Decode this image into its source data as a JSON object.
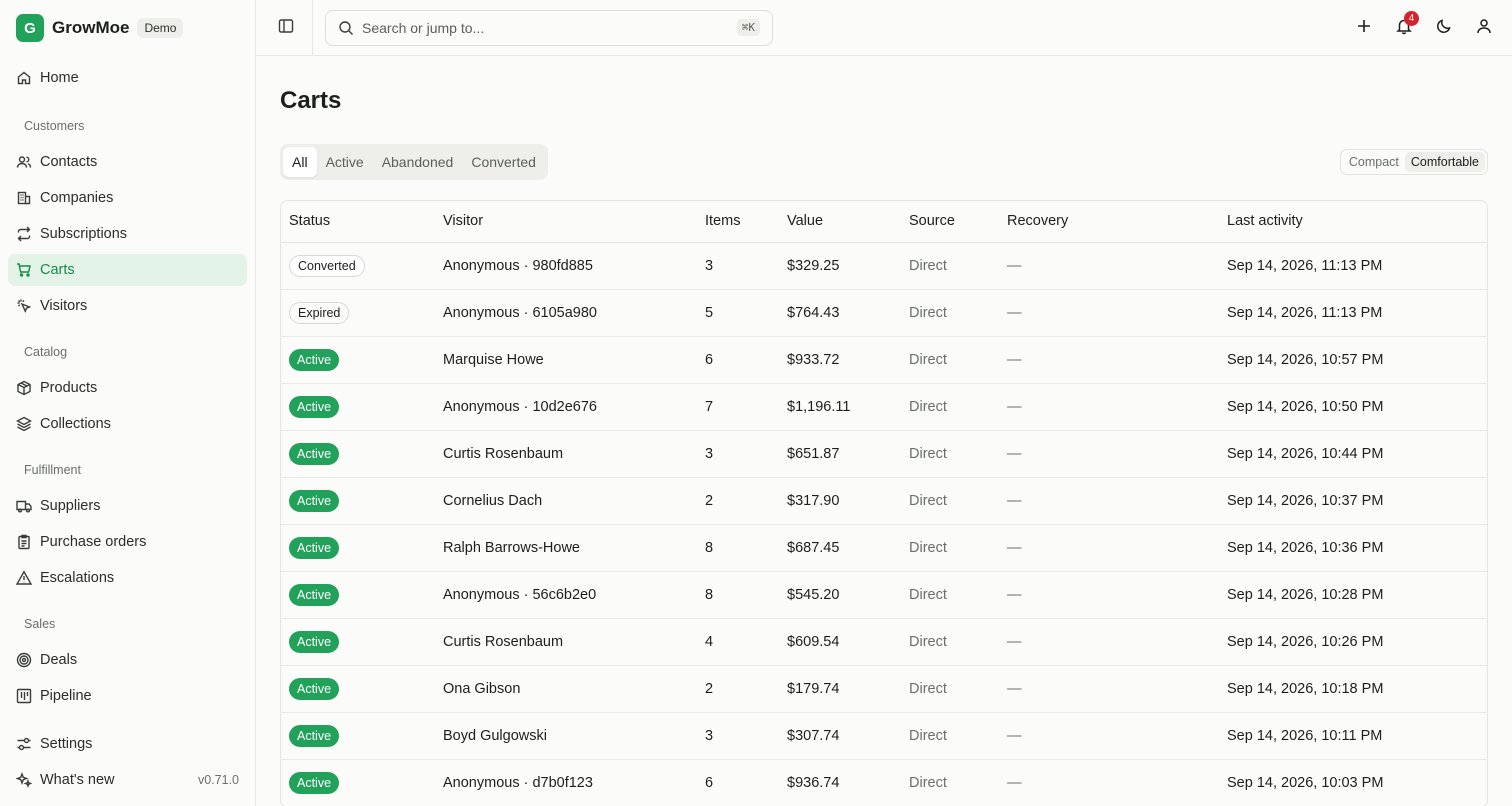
{
  "brand": {
    "logo_letter": "G",
    "name": "GrowMoe",
    "badge": "Demo"
  },
  "sidebar": {
    "home": "Home",
    "sections": [
      {
        "title": "Customers",
        "items": [
          {
            "label": "Contacts",
            "icon": "users-icon"
          },
          {
            "label": "Companies",
            "icon": "building-icon"
          },
          {
            "label": "Subscriptions",
            "icon": "repeat-icon"
          },
          {
            "label": "Carts",
            "icon": "cart-icon",
            "active": true
          },
          {
            "label": "Visitors",
            "icon": "cursor-click-icon"
          }
        ]
      },
      {
        "title": "Catalog",
        "items": [
          {
            "label": "Products",
            "icon": "box-icon"
          },
          {
            "label": "Collections",
            "icon": "layers-icon"
          }
        ]
      },
      {
        "title": "Fulfillment",
        "items": [
          {
            "label": "Suppliers",
            "icon": "truck-icon"
          },
          {
            "label": "Purchase orders",
            "icon": "clipboard-icon"
          },
          {
            "label": "Escalations",
            "icon": "warning-icon"
          }
        ]
      },
      {
        "title": "Sales",
        "items": [
          {
            "label": "Deals",
            "icon": "target-icon"
          },
          {
            "label": "Pipeline",
            "icon": "kanban-icon"
          }
        ]
      }
    ],
    "settings": "Settings",
    "whats_new": "What's new",
    "version": "v0.71.0"
  },
  "topbar": {
    "search_placeholder": "Search or jump to...",
    "search_shortcut": "⌘K",
    "notification_count": "4"
  },
  "page": {
    "title": "Carts",
    "tabs": [
      "All",
      "Active",
      "Abandoned",
      "Converted"
    ],
    "active_tab": "All",
    "density": {
      "compact": "Compact",
      "comfortable": "Comfortable",
      "selected": "Comfortable"
    }
  },
  "table": {
    "columns": [
      "Status",
      "Visitor",
      "Items",
      "Value",
      "Source",
      "Recovery",
      "Last activity"
    ],
    "rows": [
      {
        "status": "Converted",
        "visitor": "Anonymous · 980fd885",
        "items": "3",
        "value": "$329.25",
        "source": "Direct",
        "recovery": "—",
        "last_activity": "Sep 14, 2026, 11:13 PM"
      },
      {
        "status": "Expired",
        "visitor": "Anonymous · 6105a980",
        "items": "5",
        "value": "$764.43",
        "source": "Direct",
        "recovery": "—",
        "last_activity": "Sep 14, 2026, 11:13 PM"
      },
      {
        "status": "Active",
        "visitor": "Marquise Howe",
        "items": "6",
        "value": "$933.72",
        "source": "Direct",
        "recovery": "—",
        "last_activity": "Sep 14, 2026, 10:57 PM"
      },
      {
        "status": "Active",
        "visitor": "Anonymous · 10d2e676",
        "items": "7",
        "value": "$1,196.11",
        "source": "Direct",
        "recovery": "—",
        "last_activity": "Sep 14, 2026, 10:50 PM"
      },
      {
        "status": "Active",
        "visitor": "Curtis Rosenbaum",
        "items": "3",
        "value": "$651.87",
        "source": "Direct",
        "recovery": "—",
        "last_activity": "Sep 14, 2026, 10:44 PM"
      },
      {
        "status": "Active",
        "visitor": "Cornelius Dach",
        "items": "2",
        "value": "$317.90",
        "source": "Direct",
        "recovery": "—",
        "last_activity": "Sep 14, 2026, 10:37 PM"
      },
      {
        "status": "Active",
        "visitor": "Ralph Barrows-Howe",
        "items": "8",
        "value": "$687.45",
        "source": "Direct",
        "recovery": "—",
        "last_activity": "Sep 14, 2026, 10:36 PM"
      },
      {
        "status": "Active",
        "visitor": "Anonymous · 56c6b2e0",
        "items": "8",
        "value": "$545.20",
        "source": "Direct",
        "recovery": "—",
        "last_activity": "Sep 14, 2026, 10:28 PM"
      },
      {
        "status": "Active",
        "visitor": "Curtis Rosenbaum",
        "items": "4",
        "value": "$609.54",
        "source": "Direct",
        "recovery": "—",
        "last_activity": "Sep 14, 2026, 10:26 PM"
      },
      {
        "status": "Active",
        "visitor": "Ona Gibson",
        "items": "2",
        "value": "$179.74",
        "source": "Direct",
        "recovery": "—",
        "last_activity": "Sep 14, 2026, 10:18 PM"
      },
      {
        "status": "Active",
        "visitor": "Boyd Gulgowski",
        "items": "3",
        "value": "$307.74",
        "source": "Direct",
        "recovery": "—",
        "last_activity": "Sep 14, 2026, 10:11 PM"
      },
      {
        "status": "Active",
        "visitor": "Anonymous · d7b0f123",
        "items": "6",
        "value": "$936.74",
        "source": "Direct",
        "recovery": "—",
        "last_activity": "Sep 14, 2026, 10:03 PM"
      }
    ]
  },
  "colors": {
    "accent": "#22a15a",
    "accent_soft": "#e4f3e8",
    "notification": "#d6232b"
  }
}
